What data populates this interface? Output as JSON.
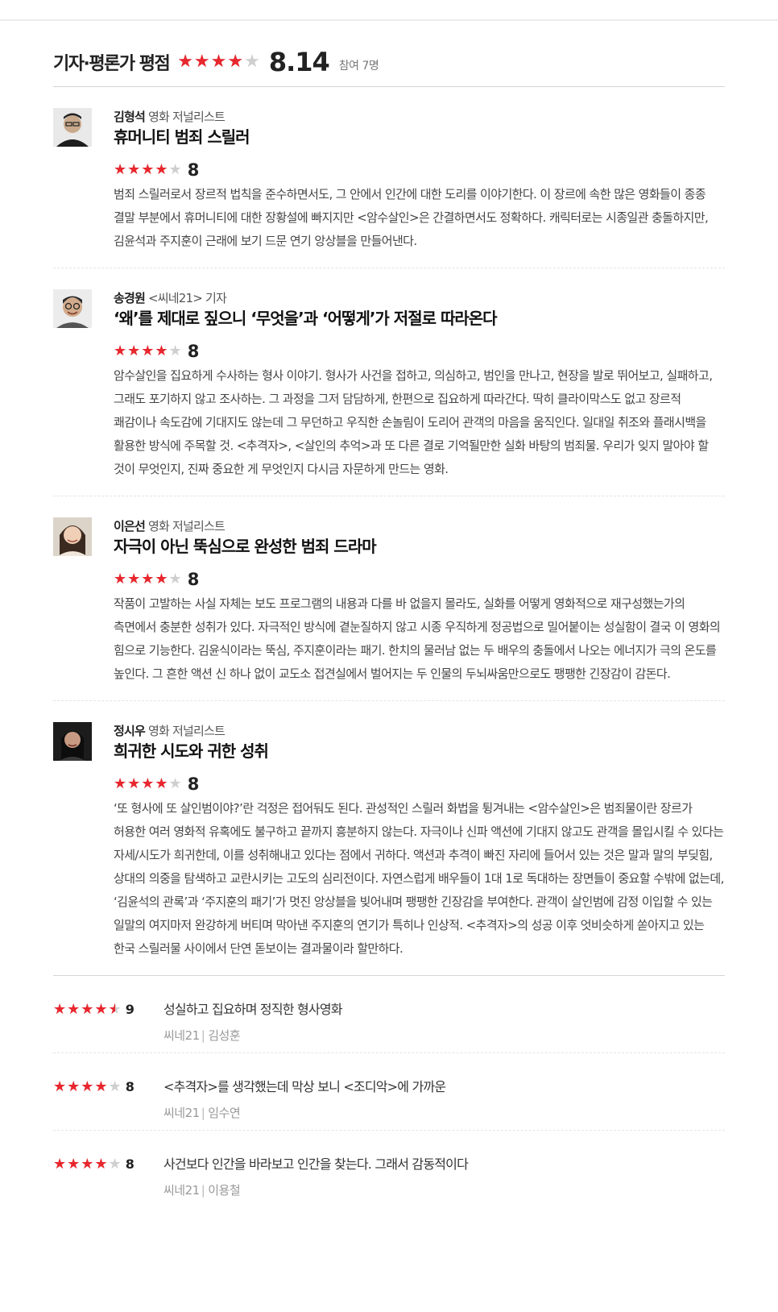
{
  "header": {
    "title": "기자·평론가 평점",
    "rating_fraction": 0.814,
    "average_score": "8.14",
    "participants": "참여 7명"
  },
  "colors": {
    "star_active": "#e8262d",
    "star_inactive": "#cfcfcf"
  },
  "reviews": [
    {
      "author": "김형석",
      "affiliation": "영화 저널리스트",
      "title": "휴머니티 범죄 스릴러",
      "score": "8",
      "rating_fraction": 0.8,
      "avatar_icon": "person-photo-icon",
      "text": "범죄 스릴러로서 장르적 법칙을 준수하면서도, 그 안에서 인간에 대한 도리를 이야기한다. 이 장르에 속한 많은 영화들이 종종 결말 부분에서 휴머니티에 대한 장황설에 빠지지만 <암수살인>은 간결하면서도 정확하다. 캐릭터로는 시종일관 충돌하지만, 김윤석과 주지훈이 근래에 보기 드문 연기 앙상블을 만들어낸다."
    },
    {
      "author": "송경원",
      "affiliation": "<씨네21> 기자",
      "title": "‘왜’를 제대로 짚으니 ‘무엇을’과 ‘어떻게’가 저절로 따라온다",
      "score": "8",
      "rating_fraction": 0.8,
      "avatar_icon": "person-photo-icon",
      "text": "암수살인을 집요하게 수사하는 형사 이야기. 형사가 사건을 접하고, 의심하고, 범인을 만나고, 현장을 발로 뛰어보고, 실패하고, 그래도 포기하지 않고 조사하는. 그 과정을 그저 담담하게, 한편으로 집요하게 따라간다. 딱히 클라이막스도 없고 장르적 쾌감이나 속도감에 기대지도 않는데 그 무던하고 우직한 손놀림이 도리어 관객의 마음을 움직인다. 일대일 취조와 플래시백을 활용한 방식에 주목할 것. <추격자>, <살인의 추억>과 또 다른 결로 기억될만한 실화 바탕의 범죄물. 우리가 잊지 말아야 할 것이 무엇인지, 진짜 중요한 게 무엇인지 다시금 자문하게 만드는 영화."
    },
    {
      "author": "이은선",
      "affiliation": "영화 저널리스트",
      "title": "자극이 아닌 뚝심으로 완성한 범죄 드라마",
      "score": "8",
      "rating_fraction": 0.8,
      "avatar_icon": "person-photo-icon",
      "text": "작품이 고발하는 사실 자체는 보도 프로그램의 내용과 다를 바 없을지 몰라도, 실화를 어떻게 영화적으로 재구성했는가의 측면에서 충분한 성취가 있다. 자극적인 방식에 곁눈질하지 않고 시종 우직하게 정공법으로 밀어붙이는 성실함이 결국 이 영화의 힘으로 기능한다. 김윤식이라는 뚝심, 주지훈이라는 패기. 한치의 물러남 없는 두 배우의 충돌에서 나오는 에너지가 극의 온도를 높인다. 그 흔한 액션 신 하나 없이 교도소 접견실에서 벌어지는 두 인물의 두뇌싸움만으로도 팽팽한 긴장감이 감돈다."
    },
    {
      "author": "정시우",
      "affiliation": "영화 저널리스트",
      "title": "희귀한 시도와 귀한 성취",
      "score": "8",
      "rating_fraction": 0.8,
      "avatar_icon": "person-photo-icon",
      "text": "‘또 형사에 또 살인범이야?’란 걱정은 접어둬도 된다. 관성적인 스릴러 화법을 튕겨내는 <암수살인>은 범죄물이란 장르가 허용한 여러 영화적 유혹에도 불구하고 끝까지 흥분하지 않는다. 자극이나 신파 액션에 기대지 않고도 관객을 몰입시킬 수 있다는 자세/시도가 희귀한데, 이를 성취해내고 있다는 점에서 귀하다. 액션과 추격이 빠진 자리에 들어서 있는 것은 말과 말의 부딪힘, 상대의 의중을 탐색하고 교란시키는 고도의 심리전이다. 자연스럽게 배우들이 1대 1로 독대하는 장면들이 중요할 수밖에 없는데, ‘김윤석의 관록’과 ‘주지훈의 패기’가 멋진 앙상블을 빚어내며 팽팽한 긴장감을 부여한다. 관객이 살인범에 감정 이입할 수 있는 일말의 여지마저 완강하게 버티며 막아낸 주지훈의 연기가 특히나 인상적. <추격자>의 성공 이후 엇비슷하게 쏟아지고 있는 한국 스릴러물 사이에서 단연 돋보이는 결과물이라 할만하다."
    }
  ],
  "short_reviews": [
    {
      "score": "9",
      "rating_fraction": 0.9,
      "text": "성실하고 집요하며 정직한 형사영화",
      "source": "씨네21",
      "author": "김성훈"
    },
    {
      "score": "8",
      "rating_fraction": 0.8,
      "text": "<추격자>를 생각했는데 막상 보니 <조디악>에 가까운",
      "source": "씨네21",
      "author": "임수연"
    },
    {
      "score": "8",
      "rating_fraction": 0.8,
      "text": "사건보다 인간을 바라보고 인간을 찾는다. 그래서 감동적이다",
      "source": "씨네21",
      "author": "이용철"
    }
  ]
}
